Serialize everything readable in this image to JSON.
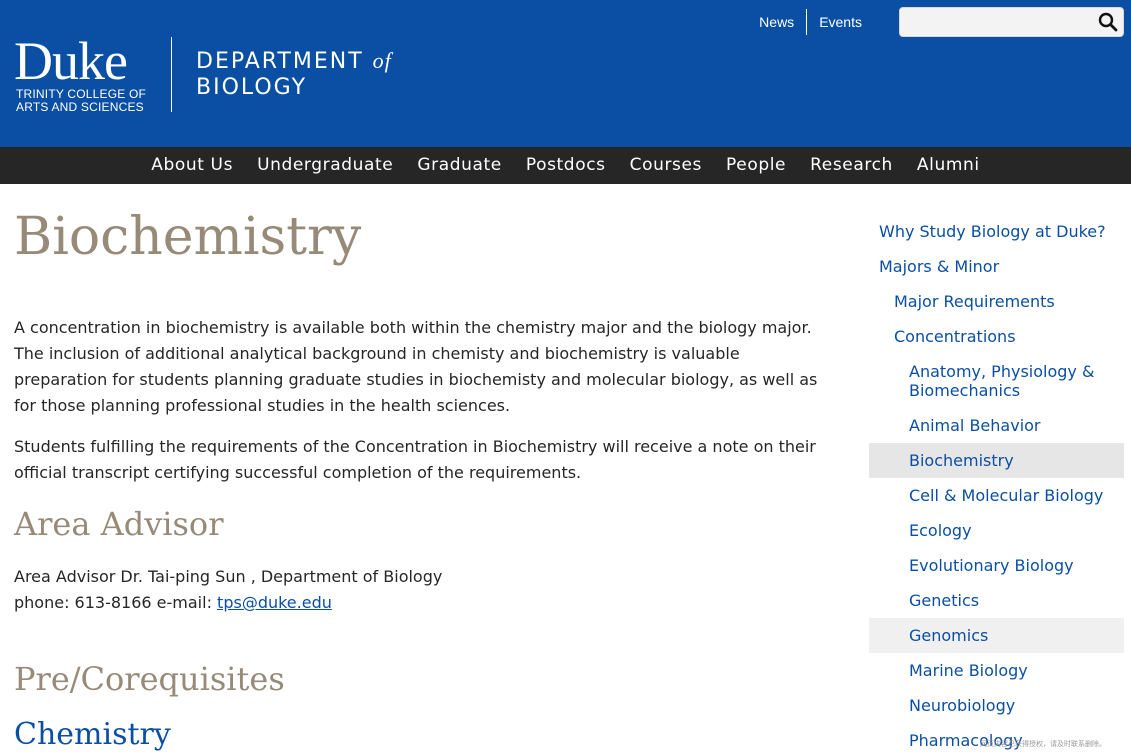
{
  "header": {
    "logo_main": "Duke",
    "logo_sub_line1": "TRINITY COLLEGE OF",
    "logo_sub_line2": "ARTS AND SCIENCES",
    "dept_line1": "DEPARTMENT",
    "dept_of": "of",
    "dept_line2": "BIOLOGY",
    "brand_color": "#0a4fa3"
  },
  "utility": {
    "news": "News",
    "events": "Events",
    "search_placeholder": "",
    "search_icon": "search-icon"
  },
  "nav": [
    "About Us",
    "Undergraduate",
    "Graduate",
    "Postdocs",
    "Courses",
    "People",
    "Research",
    "Alumni"
  ],
  "main": {
    "title": "Biochemistry",
    "paragraph1": "A concentration in biochemistry is available both within the chemistry major and the biology major. The inclusion of additional analytical background in chemisty and biochemistry is valuable preparation for students planning graduate studies in biochemisty and molecular biology, as well as for those planning professional studies in the health sciences.",
    "paragraph2": "Students fulfilling the requirements of the Concentration in Biochemistry will receive a note on their official transcript certifying successful completion of the requirements.",
    "advisor_heading": "Area Advisor",
    "advisor_line": "Area Advisor Dr. Tai-ping Sun , Department of Biology",
    "phone_prefix": "phone: 613-8166 e-mail: ",
    "email": "tps@duke.edu",
    "prereq_heading": "Pre/Corequisites",
    "chem_heading": "Chemistry"
  },
  "sidebar": [
    {
      "label": "Why Study Biology at Duke?",
      "level": 0
    },
    {
      "label": "Majors & Minor",
      "level": 0
    },
    {
      "label": "Major Requirements",
      "level": 1
    },
    {
      "label": "Concentrations",
      "level": 1
    },
    {
      "label": "Anatomy, Physiology & Biomechanics",
      "level": 2
    },
    {
      "label": "Animal Behavior",
      "level": 2
    },
    {
      "label": "Biochemistry",
      "level": 2,
      "active": true
    },
    {
      "label": "Cell & Molecular Biology",
      "level": 2
    },
    {
      "label": "Ecology",
      "level": 2
    },
    {
      "label": "Evolutionary Biology",
      "level": 2
    },
    {
      "label": "Genetics",
      "level": 2
    },
    {
      "label": "Genomics",
      "level": 2,
      "hover": true
    },
    {
      "label": "Marine Biology",
      "level": 2
    },
    {
      "label": "Neurobiology",
      "level": 2
    },
    {
      "label": "Pharmacology",
      "level": 2
    }
  ],
  "watermark": "网页内容已获得授权，请及时联系删除。"
}
